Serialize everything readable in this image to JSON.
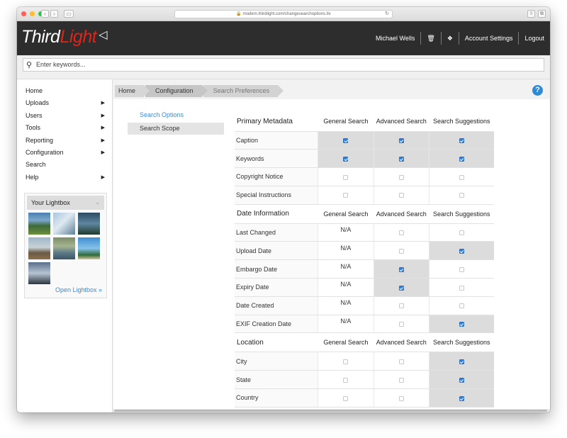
{
  "browser": {
    "url": "modern.thirdlight.com/changesearchoptions.tlx",
    "traffic_colors": [
      "#fe5f57",
      "#febc2e",
      "#28c840"
    ]
  },
  "header": {
    "logo_text_white": "Third",
    "logo_text_red": "Light",
    "user_name": "Michael Wells",
    "account_settings": "Account Settings",
    "logout": "Logout"
  },
  "search": {
    "placeholder": "Enter keywords..."
  },
  "sidebar": {
    "items": [
      {
        "label": "Home",
        "arrow": ""
      },
      {
        "label": "Uploads",
        "arrow": "▶"
      },
      {
        "label": "Users",
        "arrow": "▶"
      },
      {
        "label": "Tools",
        "arrow": "▶"
      },
      {
        "label": "Reporting",
        "arrow": "▶"
      },
      {
        "label": "Configuration",
        "arrow": "▶"
      },
      {
        "label": "Search",
        "arrow": ""
      },
      {
        "label": "Help",
        "arrow": "▶"
      }
    ]
  },
  "lightbox": {
    "title": "Your Lightbox",
    "open_label": "Open Lightbox »"
  },
  "breadcrumb": [
    "Home",
    "Configuration",
    "Search Preferences"
  ],
  "subnav": {
    "search_options": "Search Options",
    "search_scope": "Search Scope"
  },
  "columns": [
    "General Search",
    "Advanced Search",
    "Search Suggestions"
  ],
  "sections": [
    {
      "title": "Primary Metadata",
      "rows": [
        {
          "label": "Caption",
          "values": [
            true,
            true,
            true
          ]
        },
        {
          "label": "Keywords",
          "values": [
            true,
            true,
            true
          ]
        },
        {
          "label": "Copyright Notice",
          "values": [
            false,
            false,
            false
          ]
        },
        {
          "label": "Special Instructions",
          "values": [
            false,
            false,
            false
          ]
        }
      ]
    },
    {
      "title": "Date Information",
      "rows": [
        {
          "label": "Last Changed",
          "values": [
            "N/A",
            false,
            false
          ]
        },
        {
          "label": "Upload Date",
          "values": [
            "N/A",
            false,
            true
          ]
        },
        {
          "label": "Embargo Date",
          "values": [
            "N/A",
            true,
            false
          ]
        },
        {
          "label": "Expiry Date",
          "values": [
            "N/A",
            true,
            false
          ]
        },
        {
          "label": "Date Created",
          "values": [
            "N/A",
            false,
            false
          ]
        },
        {
          "label": "EXIF Creation Date",
          "values": [
            "N/A",
            false,
            true
          ]
        }
      ]
    },
    {
      "title": "Location",
      "rows": [
        {
          "label": "City",
          "values": [
            false,
            false,
            true
          ]
        },
        {
          "label": "State",
          "values": [
            false,
            false,
            true
          ]
        },
        {
          "label": "Country",
          "values": [
            false,
            false,
            true
          ]
        }
      ]
    }
  ]
}
